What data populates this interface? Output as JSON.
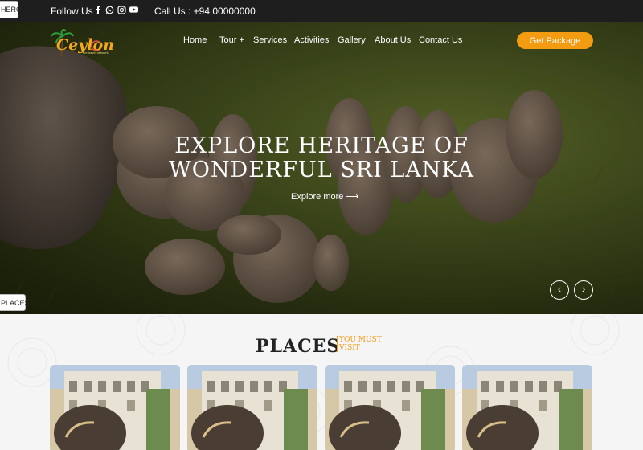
{
  "tags": {
    "hero": "HERO",
    "places": "PLACES"
  },
  "topbar": {
    "follow_label": "Follow Us :",
    "socials": [
      "facebook-icon",
      "whatsapp-icon",
      "instagram-icon",
      "youtube-icon"
    ],
    "call_label": "Call Us : +94 00000000"
  },
  "brand": {
    "name": "Ceylon",
    "tagline": "the travel network"
  },
  "nav": {
    "items": [
      {
        "label": "Home"
      },
      {
        "label": "Tour +"
      },
      {
        "label": "Services"
      },
      {
        "label": "Activities"
      },
      {
        "label": "Gallery"
      },
      {
        "label": "About Us"
      },
      {
        "label": "Contact Us"
      }
    ],
    "cta": "Get Package"
  },
  "hero": {
    "headline_line1": "EXPLORE HERITAGE OF",
    "headline_line2": "WONDERFUL SRI LANKA",
    "explore_label": "Explore more ⟶",
    "prev_label": "‹",
    "next_label": "›"
  },
  "places": {
    "title": "PLACES",
    "subtitle": "YOU MUST VISIT",
    "cards": [
      "place-card-1",
      "place-card-2",
      "place-card-3",
      "place-card-4"
    ]
  },
  "colors": {
    "accent": "#f39c12",
    "topbar": "#1e1e1e"
  }
}
